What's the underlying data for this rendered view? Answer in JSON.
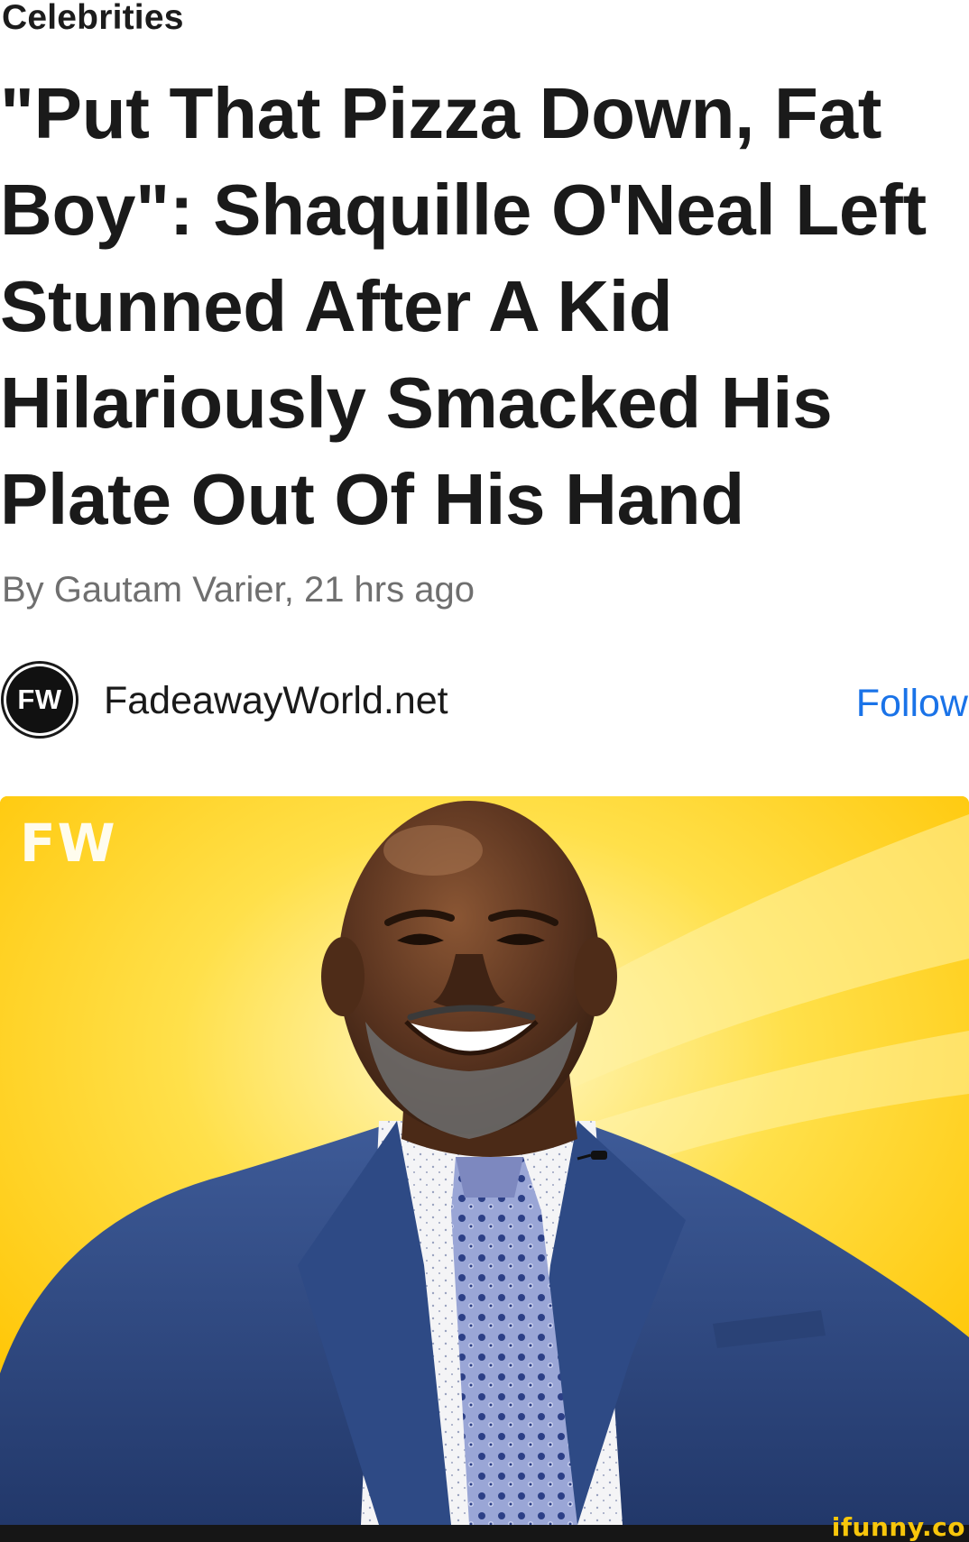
{
  "article": {
    "category": "Celebrities",
    "headline": "\"Put That Pizza Down, Fat Boy\": Shaquille O'Neal Left Stunned After A Kid Hilariously Smacked His Plate Out Of His Hand",
    "byline": "By Gautam Varier, 21 hrs ago"
  },
  "source": {
    "logo_text": "FW",
    "name": "FadeawayWorld.net",
    "follow_label": "Follow",
    "follow_color": "#1a73e8"
  },
  "hero_image": {
    "badge_text": "FW",
    "background_color": "#ffd200"
  },
  "watermark": {
    "text": "ifunny.co",
    "color": "#f8c60b"
  }
}
